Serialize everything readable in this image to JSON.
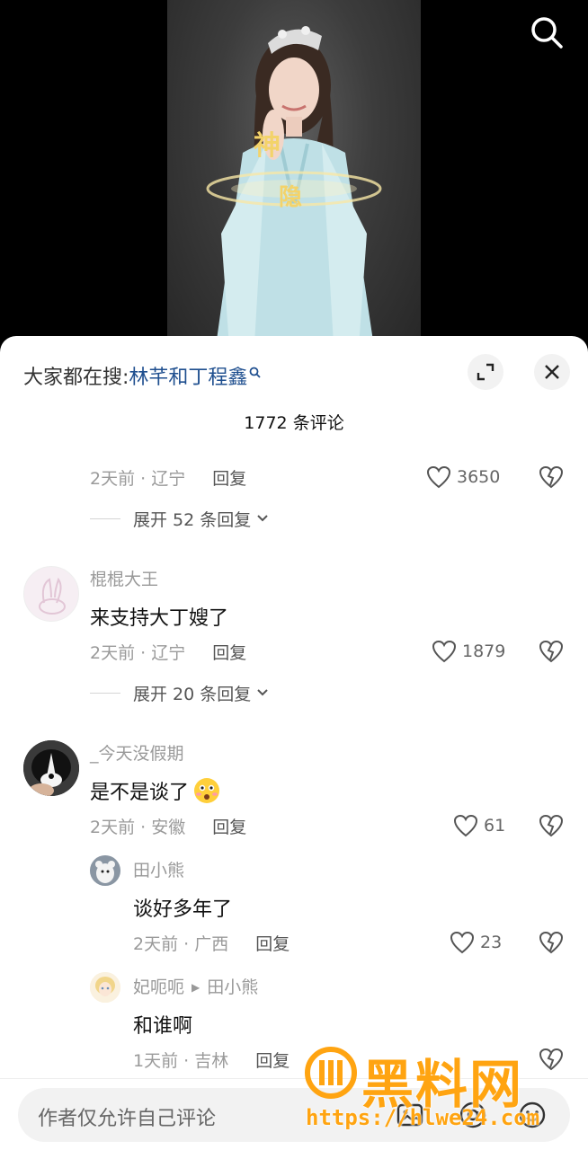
{
  "header": {
    "hot_search_prefix": "大家都在搜:",
    "hot_search_term": "林芊和丁程鑫",
    "comment_count": "1772 条评论"
  },
  "comments": [
    {
      "time_location": "2天前 · 辽宁",
      "reply_label": "回复",
      "likes": "3650",
      "expand_label": "展开 52 条回复"
    },
    {
      "username": "棍棍大王",
      "text": "来支持大丁嫂了",
      "time_location": "2天前 · 辽宁",
      "reply_label": "回复",
      "likes": "1879",
      "expand_label": "展开 20 条回复"
    },
    {
      "username": "_今天没假期",
      "text": "是不是谈了",
      "time_location": "2天前 · 安徽",
      "reply_label": "回复",
      "likes": "61",
      "replies": [
        {
          "username": "田小熊",
          "text": "谈好多年了",
          "time_location": "2天前 · 广西",
          "reply_label": "回复",
          "likes": "23"
        },
        {
          "username": "妃呃呃",
          "reply_to": "田小熊",
          "text": "和谁啊",
          "time_location": "1天前 · 吉林",
          "reply_label": "回复"
        }
      ]
    }
  ],
  "bottom_bar": {
    "input_placeholder": "作者仅允许自己评论"
  },
  "watermark": {
    "title": "黑料网",
    "url": "https://hlwe24.com"
  },
  "icons": {
    "search": "search-icon",
    "expand": "expand-icon",
    "close": "close-icon",
    "like": "heart-icon",
    "dislike": "broken-heart-icon",
    "emoji": "surprised-emoji-icon",
    "image": "image-icon",
    "at": "at-icon",
    "smile": "emoji-icon"
  },
  "colors": {
    "hot_search_term": "#1f4f8f",
    "watermark": "#ffa411",
    "sheet_bg": "#ffffff"
  }
}
